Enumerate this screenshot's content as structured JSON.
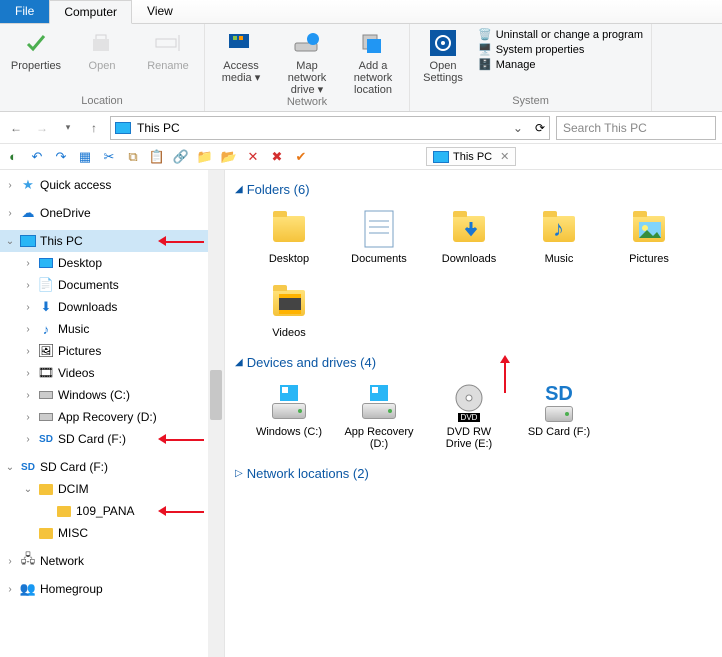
{
  "tabs": {
    "file": "File",
    "computer": "Computer",
    "view": "View"
  },
  "ribbon": {
    "location": {
      "label": "Location",
      "properties": "Properties",
      "open": "Open",
      "rename": "Rename"
    },
    "network": {
      "label": "Network",
      "access": "Access media",
      "map": "Map network drive",
      "add": "Add a network location"
    },
    "settings": {
      "label": "Open Settings"
    },
    "system": {
      "label": "System",
      "uninstall": "Uninstall or change a program",
      "props": "System properties",
      "manage": "Manage"
    }
  },
  "address": {
    "location": "This PC"
  },
  "search": {
    "placeholder": "Search This PC"
  },
  "pathtab": {
    "label": "This PC"
  },
  "tree": [
    {
      "lbl": "Quick access",
      "ic": "star",
      "ind": 0,
      "exp": "›"
    },
    {
      "lbl": "OneDrive",
      "ic": "cloud",
      "ind": 0,
      "exp": "›"
    },
    {
      "lbl": "This PC",
      "ic": "pc",
      "ind": 0,
      "exp": "⌄",
      "sel": true,
      "arrow": true
    },
    {
      "lbl": "Desktop",
      "ic": "desk",
      "ind": 1,
      "exp": "›"
    },
    {
      "lbl": "Documents",
      "ic": "doc",
      "ind": 1,
      "exp": "›"
    },
    {
      "lbl": "Downloads",
      "ic": "dl",
      "ind": 1,
      "exp": "›"
    },
    {
      "lbl": "Music",
      "ic": "music",
      "ind": 1,
      "exp": "›"
    },
    {
      "lbl": "Pictures",
      "ic": "pic",
      "ind": 1,
      "exp": "›"
    },
    {
      "lbl": "Videos",
      "ic": "vid",
      "ind": 1,
      "exp": "›"
    },
    {
      "lbl": "Windows (C:)",
      "ic": "drv",
      "ind": 1,
      "exp": "›"
    },
    {
      "lbl": "App Recovery (D:)",
      "ic": "drv",
      "ind": 1,
      "exp": "›"
    },
    {
      "lbl": "SD Card (F:)",
      "ic": "sd",
      "ind": 1,
      "exp": "›",
      "arrow": true
    },
    {
      "lbl": "SD Card (F:)",
      "ic": "sd",
      "ind": 0,
      "exp": "⌄"
    },
    {
      "lbl": "DCIM",
      "ic": "fld",
      "ind": 1,
      "exp": "⌄"
    },
    {
      "lbl": "109_PANA",
      "ic": "fld",
      "ind": 2,
      "exp": " ",
      "arrow": true
    },
    {
      "lbl": "MISC",
      "ic": "fld",
      "ind": 1,
      "exp": " "
    },
    {
      "lbl": "Network",
      "ic": "net",
      "ind": 0,
      "exp": "›"
    },
    {
      "lbl": "Homegroup",
      "ic": "hg",
      "ind": 0,
      "exp": "›"
    }
  ],
  "sections": {
    "folders": {
      "title": "Folders (6)",
      "items": [
        {
          "lbl": "Desktop",
          "ic": "folder"
        },
        {
          "lbl": "Documents",
          "ic": "doc"
        },
        {
          "lbl": "Downloads",
          "ic": "dl"
        },
        {
          "lbl": "Music",
          "ic": "music"
        },
        {
          "lbl": "Pictures",
          "ic": "pic"
        },
        {
          "lbl": "Videos",
          "ic": "vid"
        }
      ]
    },
    "devices": {
      "title": "Devices and drives (4)",
      "items": [
        {
          "lbl": "Windows (C:)",
          "ic": "drv"
        },
        {
          "lbl": "App Recovery (D:)",
          "ic": "drv"
        },
        {
          "lbl": "DVD RW Drive (E:)",
          "ic": "dvd"
        },
        {
          "lbl": "SD Card (F:)",
          "ic": "sd"
        }
      ]
    },
    "network": {
      "title": "Network locations (2)"
    }
  }
}
